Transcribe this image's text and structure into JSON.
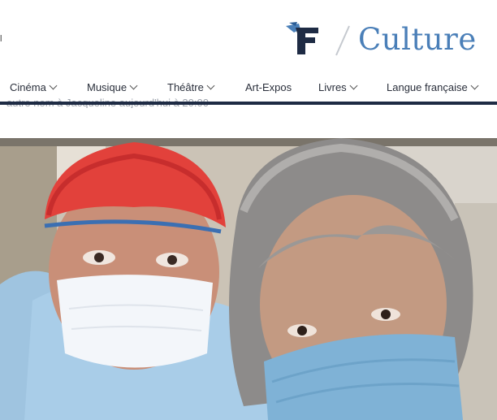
{
  "header": {
    "left_edge_text": "l",
    "section_title": "Culture",
    "logo_letter": "F"
  },
  "nav": {
    "items": [
      {
        "label": "Cinéma",
        "dropdown": true
      },
      {
        "label": "Musique",
        "dropdown": true
      },
      {
        "label": "Théâtre",
        "dropdown": true
      },
      {
        "label": "Art-Expos",
        "dropdown": false
      },
      {
        "label": "Livres",
        "dropdown": true
      },
      {
        "label": "Langue française",
        "dropdown": true
      }
    ]
  },
  "article": {
    "subtext": "autre nom à Jacqueline aujourd'hui à 20:00"
  },
  "colors": {
    "accent": "#4a7fb8",
    "nav_bar": "#1e2b44",
    "logo_dark": "#1e2b44",
    "logo_blue": "#4a7fb8"
  }
}
